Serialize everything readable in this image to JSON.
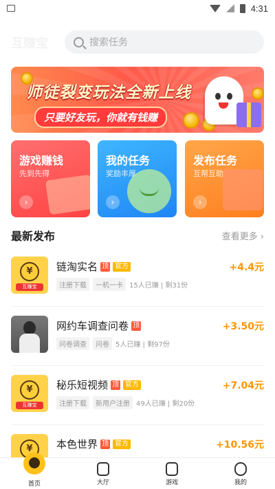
{
  "status_bar": {
    "time": "4:31"
  },
  "header": {
    "logo_text": "互赚宝",
    "search_placeholder": "搜索任务"
  },
  "banner": {
    "title": "师徒裂变玩法全新上线",
    "subtitle": "只要好友玩，你就有钱赚"
  },
  "categories": [
    {
      "title": "游戏赚钱",
      "subtitle": "先到先得"
    },
    {
      "title": "我的任务",
      "subtitle": "奖励丰厚"
    },
    {
      "title": "发布任务",
      "subtitle": "互帮互助"
    }
  ],
  "latest": {
    "title": "最新发布",
    "more": "查看更多"
  },
  "tasks": [
    {
      "name": "链淘实名",
      "top": "顶",
      "official": "官方",
      "tags": [
        "注册下载",
        "一机一卡"
      ],
      "stats": "15人已赚 | 剩31份",
      "reward": "+4.4元",
      "thumb": "mascot"
    },
    {
      "name": "网约车调查问卷",
      "top": "顶",
      "official": "",
      "tags": [
        "问卷调查",
        "问卷"
      ],
      "stats": "5人已赚 | 剩97份",
      "reward": "+3.50元",
      "thumb": "photo"
    },
    {
      "name": "秘乐短视频",
      "top": "顶",
      "official": "官方",
      "tags": [
        "注册下载",
        "新用户注册"
      ],
      "stats": "49人已赚 | 剩20份",
      "reward": "+7.04元",
      "thumb": "mascot"
    },
    {
      "name": "本色世界",
      "top": "顶",
      "official": "官方",
      "tags": [],
      "stats": "",
      "reward": "+10.56元",
      "thumb": "mascot"
    }
  ],
  "mascot_label": "互赚宝",
  "mascot_symbol": "¥",
  "nav": [
    {
      "label": "首页",
      "icon": "home-icon"
    },
    {
      "label": "大厅",
      "icon": "hall-icon"
    },
    {
      "label": "游戏",
      "icon": "game-icon"
    },
    {
      "label": "我的",
      "icon": "profile-icon"
    }
  ],
  "colors": {
    "accent": "#ffc21a",
    "reward": "#ff9500",
    "badge_top": "#ff5a3c",
    "badge_official": "#ffb800"
  }
}
